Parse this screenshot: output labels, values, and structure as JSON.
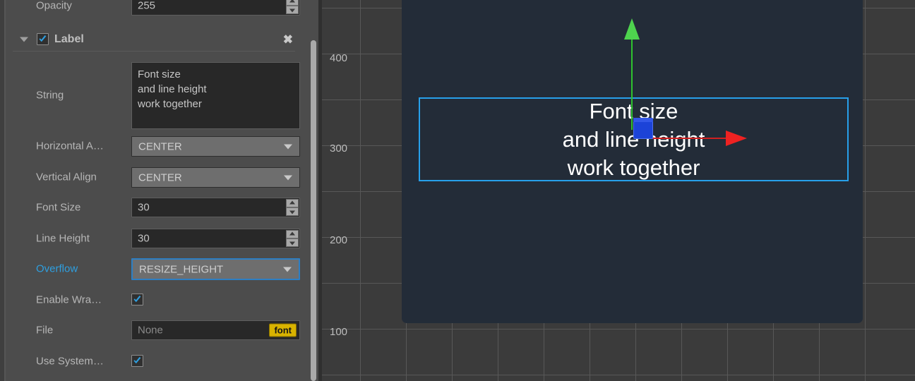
{
  "inspector": {
    "scroll_top_row": {
      "label": "Opacity",
      "value": "255"
    },
    "section": {
      "title": "Label",
      "checked": true,
      "close_label": "✖",
      "disclosure": "expanded"
    },
    "properties": [
      {
        "label": "String",
        "type": "textarea",
        "value": "Font size\nand line height\nwork together"
      },
      {
        "label": "Horizontal A…",
        "type": "combo",
        "value": "CENTER"
      },
      {
        "label": "Vertical Align",
        "type": "combo",
        "value": "CENTER"
      },
      {
        "label": "Font Size",
        "type": "spinner",
        "value": "30"
      },
      {
        "label": "Line Height",
        "type": "spinner",
        "value": "30"
      },
      {
        "label": "Overflow",
        "type": "combo",
        "value": "RESIZE_HEIGHT",
        "focused": true,
        "label_accent": true
      },
      {
        "label": "Enable Wra…",
        "type": "checkbox",
        "checked": true
      },
      {
        "label": "File",
        "type": "file",
        "value": "None",
        "badge": "font"
      },
      {
        "label": "Use System…",
        "type": "checkbox",
        "checked": true
      }
    ]
  },
  "viewport": {
    "ruler_labels": [
      "400",
      "300",
      "200",
      "100"
    ],
    "scene_text_lines": [
      "Font size",
      "and line height",
      "work together"
    ],
    "gizmo": {
      "y_axis_color": "#4ed34e",
      "x_axis_color": "#ee2222",
      "center_handle_color": "#1c43d8"
    },
    "selection_border_color": "#27a0ea",
    "scene_background": "#232c38"
  },
  "colors": {
    "panel_bg": "#4c4c4c",
    "field_dark": "#282828",
    "combo_bg": "#6e6e6e",
    "accent_blue": "#2e9fe0",
    "badge_yellow": "#d9b300",
    "viewport_bg": "#3b3b3b"
  }
}
